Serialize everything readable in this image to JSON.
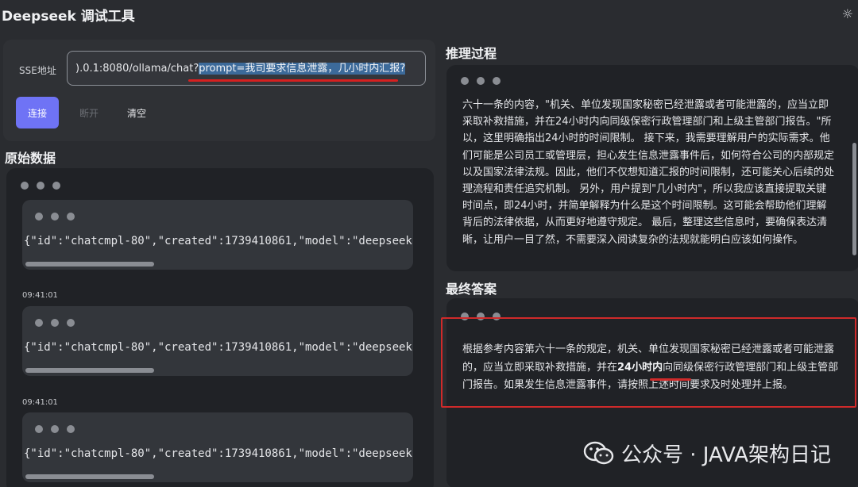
{
  "app": {
    "title": "Deepseek 调试工具",
    "theme_icon": "sun-icon"
  },
  "connection": {
    "sse_label": "SSE地址",
    "url_plain": ").0.1:8080/ollama/chat?",
    "url_selected": "prompt=我司要求信息泄露，几小时内汇报?",
    "connect_label": "连接",
    "disconnect_label": "断开",
    "clear_label": "清空"
  },
  "raw": {
    "title": "原始数据",
    "messages": [
      {
        "text": "{\"id\":\"chatcmpl-80\",\"created\":1739410861,\"model\":\"deepseek-",
        "time": "09:41:01"
      },
      {
        "text": "{\"id\":\"chatcmpl-80\",\"created\":1739410861,\"model\":\"deepseek-",
        "time": "09:41:01"
      },
      {
        "text": "{\"id\":\"chatcmpl-80\",\"created\":1739410861,\"model\":\"deepseek-"
      }
    ]
  },
  "reasoning": {
    "title": "推理过程",
    "text": "六十一条的内容，\"机关、单位发现国家秘密已经泄露或者可能泄露的，应当立即采取补救措施，并在24小时内向同级保密行政管理部门和上级主管部门报告。\"所以，这里明确指出24小时的时间限制。 接下来，我需要理解用户的实际需求。他们可能是公司员工或管理层，担心发生信息泄露事件后，如何符合公司的内部规定以及国家法律法规。因此，他们不仅想知道汇报的时间限制，还可能关心后续的处理流程和责任追究机制。 另外，用户提到\"几小时内\"，所以我应该直接提取关键时间点，即24小时，并简单解释为什么是这个时间限制。这可能会帮助他们理解背后的法律依据，从而更好地遵守规定。 最后，整理这些信息时，要确保表达清晰，让用户一目了然，不需要深入阅读复杂的法规就能明白应该如何操作。"
  },
  "answer": {
    "title": "最终答案",
    "before": "根据参考内容第六十一条的规定，机关、单位发现国家秘密已经泄露或者可能泄露的，应当立即采取补救措施，并在",
    "bold": "24小时内",
    "after": "向同级保密行政管理部门和上级主管部门报告。如果发生信息泄露事件，请按照上述时间要求及时处理并上报。"
  },
  "watermark": {
    "text": "公众号 · JAVA架构日记",
    "icon": "wechat-icon"
  }
}
